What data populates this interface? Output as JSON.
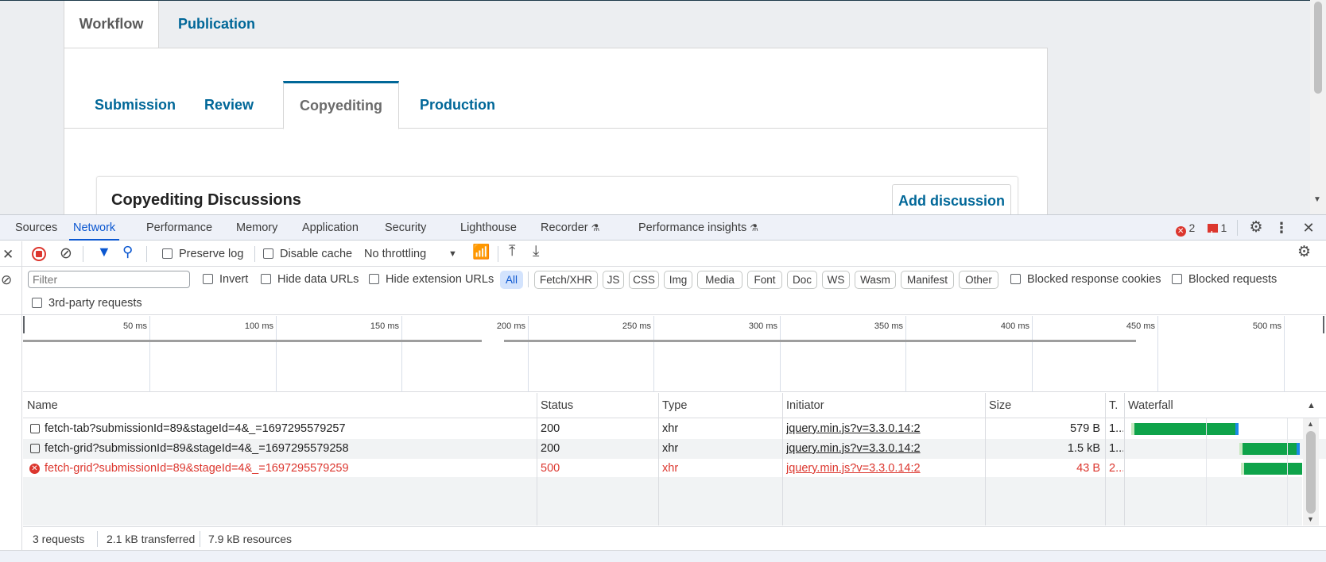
{
  "page": {
    "main_tabs": [
      "Workflow",
      "Publication"
    ],
    "stage_tabs": [
      "Submission",
      "Review",
      "Copyediting",
      "Production"
    ],
    "section_title": "Copyediting Discussions",
    "add_discussion_label": "Add discussion"
  },
  "devtools": {
    "tabs": [
      "Sources",
      "Network",
      "Performance",
      "Memory",
      "Application",
      "Security",
      "Lighthouse",
      "Recorder",
      "Performance insights"
    ],
    "active_tab": "Network",
    "error_count": "2",
    "issue_count": "1",
    "toolbar": {
      "preserve_log": "Preserve log",
      "disable_cache": "Disable cache",
      "throttling": "No throttling"
    },
    "filter": {
      "placeholder": "Filter",
      "invert": "Invert",
      "hide_data_urls": "Hide data URLs",
      "hide_extension_urls": "Hide extension URLs",
      "types": [
        "All",
        "Fetch/XHR",
        "JS",
        "CSS",
        "Img",
        "Media",
        "Font",
        "Doc",
        "WS",
        "Wasm",
        "Manifest",
        "Other"
      ],
      "active_type": "All",
      "blocked_response_cookies": "Blocked response cookies",
      "blocked_requests": "Blocked requests",
      "third_party": "3rd-party requests"
    },
    "overview_ticks": [
      "50 ms",
      "100 ms",
      "150 ms",
      "200 ms",
      "250 ms",
      "300 ms",
      "350 ms",
      "400 ms",
      "450 ms",
      "500 ms"
    ],
    "columns": [
      "Name",
      "Status",
      "Type",
      "Initiator",
      "Size",
      "T.",
      "Waterfall"
    ],
    "requests": [
      {
        "name": "fetch-tab?submissionId=89&stageId=4&_=1697295579257",
        "status": "200",
        "type": "xhr",
        "initiator": "jquery.min.js?v=3.3.0.14:2",
        "size": "579 B",
        "time": "1...",
        "error": false,
        "wf_start": 0.05,
        "wf_end": 0.62
      },
      {
        "name": "fetch-grid?submissionId=89&stageId=4&_=1697295579258",
        "status": "200",
        "type": "xhr",
        "initiator": "jquery.min.js?v=3.3.0.14:2",
        "size": "1.5 kB",
        "time": "1...",
        "error": false,
        "wf_start": 0.66,
        "wf_end": 0.97
      },
      {
        "name": "fetch-grid?submissionId=89&stageId=4&_=1697295579259",
        "status": "500",
        "type": "xhr",
        "initiator": "jquery.min.js?v=3.3.0.14:2",
        "size": "43 B",
        "time": "2...",
        "error": true,
        "wf_start": 0.67,
        "wf_end": 1.0
      }
    ],
    "status_bar": {
      "requests": "3 requests",
      "transferred": "2.1 kB transferred",
      "resources": "7.9 kB resources"
    }
  }
}
